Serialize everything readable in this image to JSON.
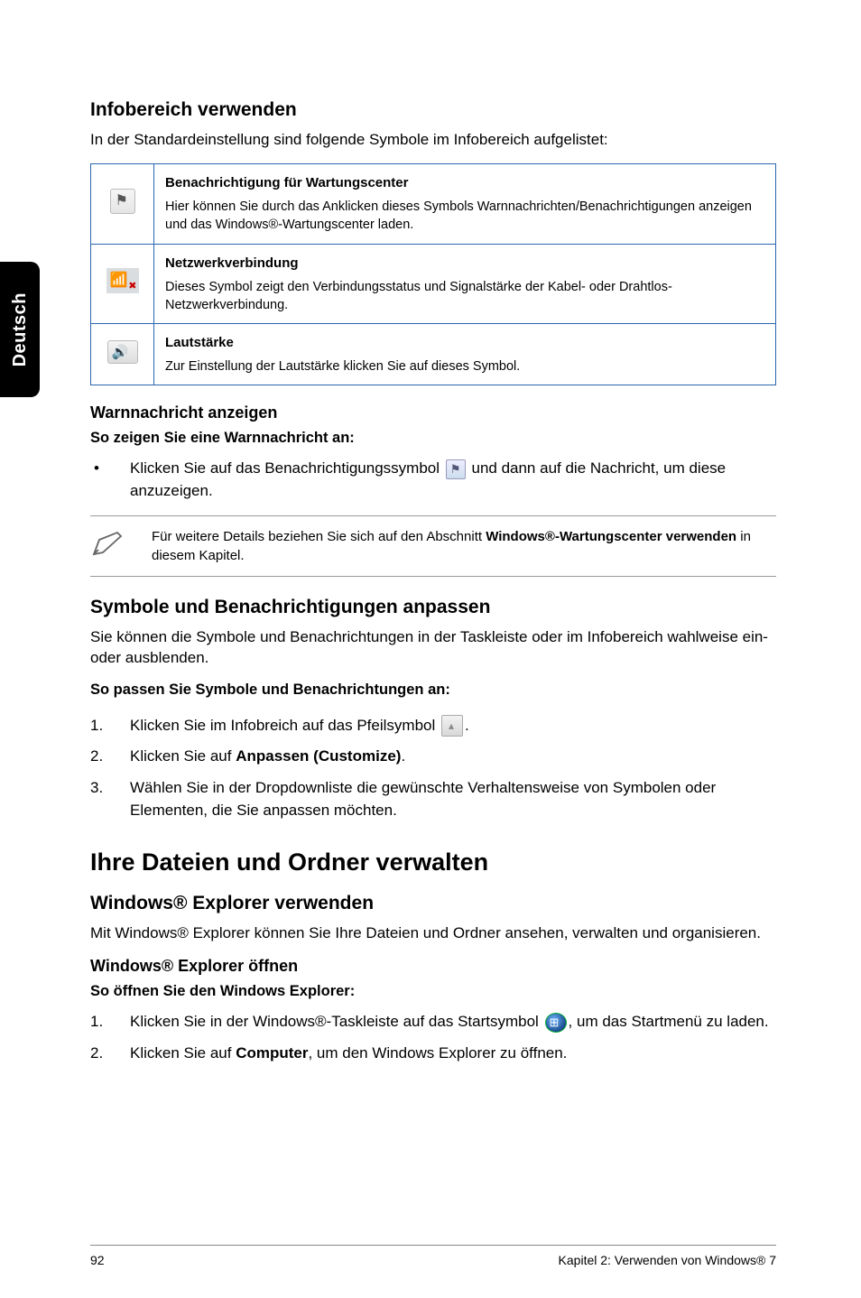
{
  "side_tab": "Deutsch",
  "s1": {
    "heading": "Infobereich verwenden",
    "intro": "In der Standardeinstellung sind folgende Symbole im Infobereich aufgelistet:",
    "rows": [
      {
        "title": "Benachrichtigung für Wartungscenter",
        "desc": "Hier können Sie durch das Anklicken dieses Symbols Warnnachrichten/Benachrichtigungen anzeigen und das Windows®-Wartungscenter laden."
      },
      {
        "title": "Netzwerkverbindung",
        "desc": "Dieses Symbol zeigt den Verbindungsstatus und Signalstärke der Kabel- oder Drahtlos-Netzwerkverbindung."
      },
      {
        "title": "Lautstärke",
        "desc": "Zur Einstellung der Lautstärke klicken Sie auf dieses Symbol."
      }
    ]
  },
  "s2": {
    "heading": "Warnnachricht anzeigen",
    "sub": "So zeigen Sie eine Warnnachricht an:",
    "bullet_a": "Klicken Sie auf das Benachrichtigungssymbol ",
    "bullet_b": " und dann auf die Nachricht, um diese anzuzeigen.",
    "note_a": "Für weitere Details beziehen Sie sich auf den Abschnitt ",
    "note_strong": "Windows®-Wartungscenter verwenden",
    "note_b": " in diesem Kapitel."
  },
  "s3": {
    "heading": "Symbole und Benachrichtigungen anpassen",
    "intro": "Sie können die Symbole und Benachrichtungen in der Taskleiste oder im Infobereich wahlweise ein- oder ausblenden.",
    "sub": "So passen Sie Symbole und Benachrichtungen an:",
    "step1_a": "Klicken Sie im Infobreich auf das Pfeilsymbol ",
    "step1_b": ".",
    "step2_a": "Klicken Sie auf ",
    "step2_strong": "Anpassen (Customize)",
    "step2_b": ".",
    "step3": "Wählen Sie in der Dropdownliste die gewünschte Verhaltensweise von Symbolen oder Elementen, die Sie anpassen möchten."
  },
  "s4": {
    "big": "Ihre Dateien und Ordner verwalten",
    "heading": "Windows® Explorer verwenden",
    "intro": "Mit Windows® Explorer können Sie Ihre Dateien und Ordner ansehen, verwalten und organisieren.",
    "sub_heading": "Windows® Explorer öffnen",
    "sub": "So öffnen Sie den Windows Explorer:",
    "step1_a": "Klicken Sie in der Windows®-Taskleiste auf das Startsymbol ",
    "step1_b": ", um das Startmenü zu laden.",
    "step2_a": "Klicken Sie auf ",
    "step2_strong": "Computer",
    "step2_b": ", um den Windows Explorer zu öffnen."
  },
  "footer": {
    "page": "92",
    "chapter": "Kapitel 2: Verwenden von Windows® 7"
  }
}
